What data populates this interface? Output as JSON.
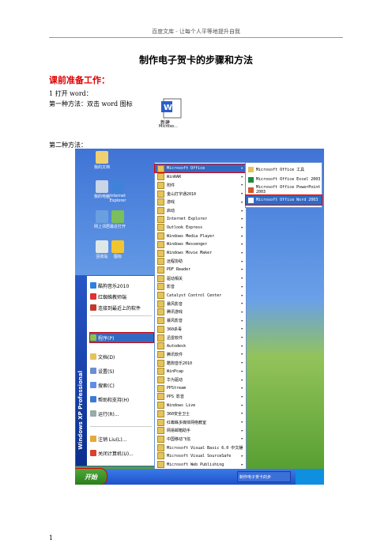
{
  "header": "百度文库 - 让每个人平等地提升自我",
  "title": "制作电子贺卡的步骤和方法",
  "section_heading": "课前准备工作：",
  "step1": "1  打开 word：",
  "method1": "第一种方法：双击 word 图标",
  "method2": "第二种方法：",
  "doc_icon": {
    "label1": "新建",
    "label2": "Microso..."
  },
  "page_number": "1",
  "desktop_icons": [
    "我的文档",
    "我的电脑",
    "网上邻居",
    "回收站",
    "Internet Explorer",
    "最近打开",
    "图标"
  ],
  "start_menu": {
    "side_text": "Windows XP Professional",
    "items": [
      "酷狗音乐2010",
      "红蜘蛛教师端",
      "连接到最近上的软件",
      "程序(P)",
      "文档(D)",
      "设置(S)",
      "搜索(C)",
      "帮助和支持(H)",
      "运行(R)...",
      "注销 Liu(L)...",
      "关闭计算机(U)..."
    ],
    "selected": "程序(P)",
    "start_label": "开始"
  },
  "programs_menu": {
    "items": [
      "Microsoft Office",
      "WinRAR",
      "附件",
      "金山打字通2010",
      "游戏",
      "启动",
      "Internet Explorer",
      "Outlook Express",
      "Windows Media Player",
      "Windows Messenger",
      "Windows Movie Maker",
      "远程协助",
      "PDF Reader",
      "驱动相关",
      "影音",
      "Catalyst Control Center",
      "暴风影音",
      "腾讯游戏",
      "暴风影音",
      "360杀毒",
      "迅雷软件",
      "Autodesk",
      "腾讯软件",
      "酷狗音乐2010",
      "WinPcap",
      "华为驱动",
      "PPStream",
      "PPS 影音",
      "Windows Live",
      "360安全卫士",
      "红蜘蛛多媒体网络教室",
      "网易邮箱助手",
      "中国移动飞信",
      "Microsoft Visual Basic 6.0 中文版",
      "Microsoft Visual SourceSafe",
      "Microsoft Web Publishing"
    ],
    "selected": "Microsoft Office"
  },
  "office_submenu": {
    "items": [
      "Microsoft Office 工具",
      "Microsoft Office Excel 2003",
      "Microsoft Office PowerPoint 2003",
      "Microsoft Office Word 2003"
    ],
    "selected": "Microsoft Office Word 2003"
  },
  "taskbar_item": "制作电子贺卡的步"
}
